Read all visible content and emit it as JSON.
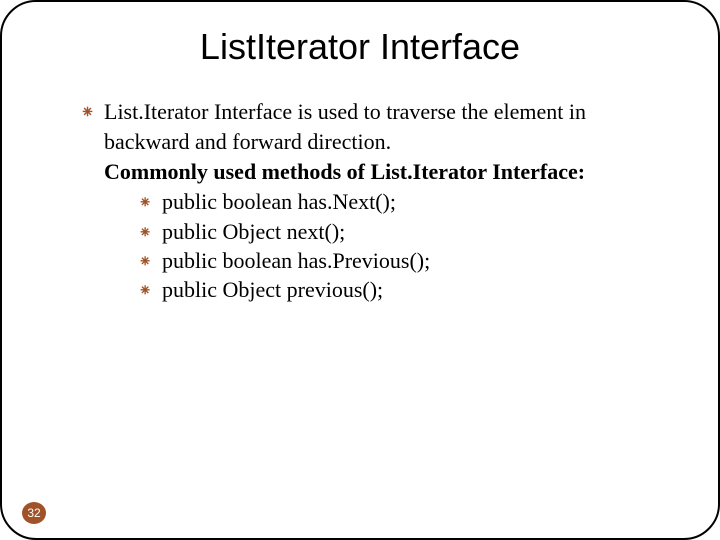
{
  "title": "ListIterator Interface",
  "bullet_icon": "⁕",
  "intro_line1": "List.Iterator Interface is used to traverse the element in",
  "intro_line2": "backward and forward direction.",
  "subtitle": "Commonly used methods of List.Iterator Interface:",
  "methods": [
    "public boolean has.Next();",
    "public Object next();",
    "public boolean has.Previous();",
    "public Object previous();"
  ],
  "page_number": "32"
}
